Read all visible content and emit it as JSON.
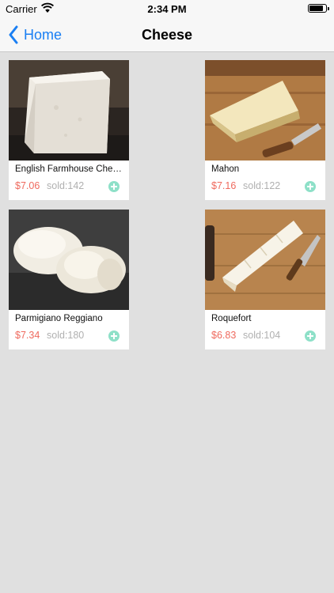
{
  "status_bar": {
    "carrier": "Carrier",
    "time": "2:34 PM"
  },
  "nav": {
    "back_label": "Home",
    "title": "Cheese"
  },
  "products": [
    {
      "name": "English Farmhouse Cheddar",
      "price": "$7.06",
      "sold": "sold:142",
      "image": "feta-block-on-slate"
    },
    {
      "name": "Mahon",
      "price": "$7.16",
      "sold": "sold:122",
      "image": "wedge-on-board-with-knife"
    },
    {
      "name": "Parmigiano Reggiano",
      "price": "$7.34",
      "sold": "sold:180",
      "image": "fresh-cheese-balls"
    },
    {
      "name": "Roquefort",
      "price": "$6.83",
      "sold": "sold:104",
      "image": "brie-wedge-with-spreader"
    }
  ],
  "colors": {
    "accent": "#1a7ff3",
    "price": "#ef6a5e",
    "add": "#8ee0c8",
    "background": "#e0e0e0"
  }
}
